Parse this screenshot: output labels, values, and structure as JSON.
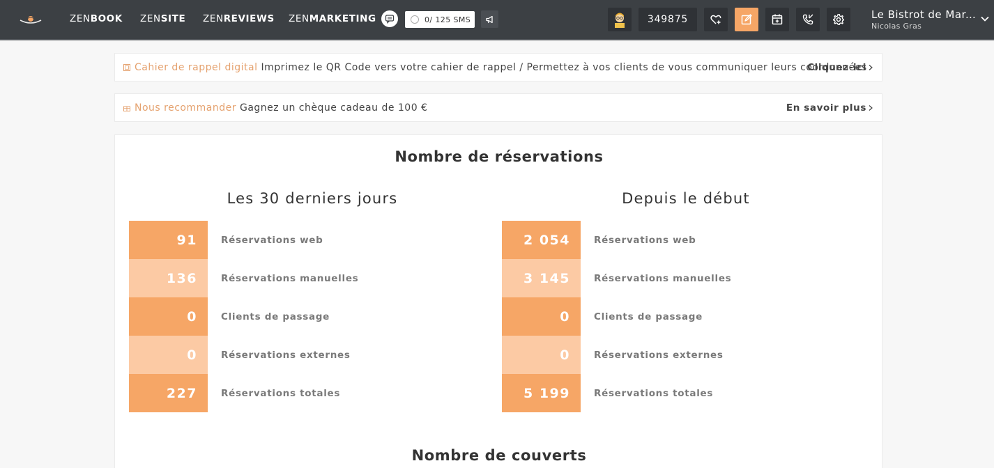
{
  "topbar": {
    "nav": [
      {
        "pre": "ZEN",
        "post": "BOOK"
      },
      {
        "pre": "ZEN",
        "post": "SITE"
      },
      {
        "pre": "ZEN",
        "post": "REVIEWS"
      },
      {
        "pre": "ZEN",
        "post": "MARKETING"
      }
    ],
    "sms": "0/ 125 SMS",
    "counter": "349875",
    "restaurant": "Le Bistrot de Mar...",
    "user": "Nicolas Gras",
    "accent": "#f6a666"
  },
  "banners": [
    {
      "highlight": "Cahier de rappel digital",
      "text": "Imprimez le QR Code vers votre cahier de rappel / Permettez à vos clients de vous communiquer leurs coordonnées",
      "cta": "Cliquez-ici"
    },
    {
      "highlight": "Nous recommander",
      "text": "Gagnez un chèque cadeau de 100 €",
      "cta": "En savoir plus"
    }
  ],
  "stats": {
    "title": "Nombre de réservations",
    "columns": [
      {
        "title": "Les 30 derniers jours",
        "rows": [
          {
            "value": "91",
            "label": "Réservations web"
          },
          {
            "value": "136",
            "label": "Réservations manuelles"
          },
          {
            "value": "0",
            "label": "Clients de passage"
          },
          {
            "value": "0",
            "label": "Réservations externes"
          },
          {
            "value": "227",
            "label": "Réservations totales"
          }
        ]
      },
      {
        "title": "Depuis le début",
        "rows": [
          {
            "value": "2 054",
            "label": "Réservations web"
          },
          {
            "value": "3 145",
            "label": "Réservations manuelles"
          },
          {
            "value": "0",
            "label": "Clients de passage"
          },
          {
            "value": "0",
            "label": "Réservations externes"
          },
          {
            "value": "5 199",
            "label": "Réservations totales"
          }
        ]
      }
    ],
    "next_title": "Nombre de couverts"
  }
}
